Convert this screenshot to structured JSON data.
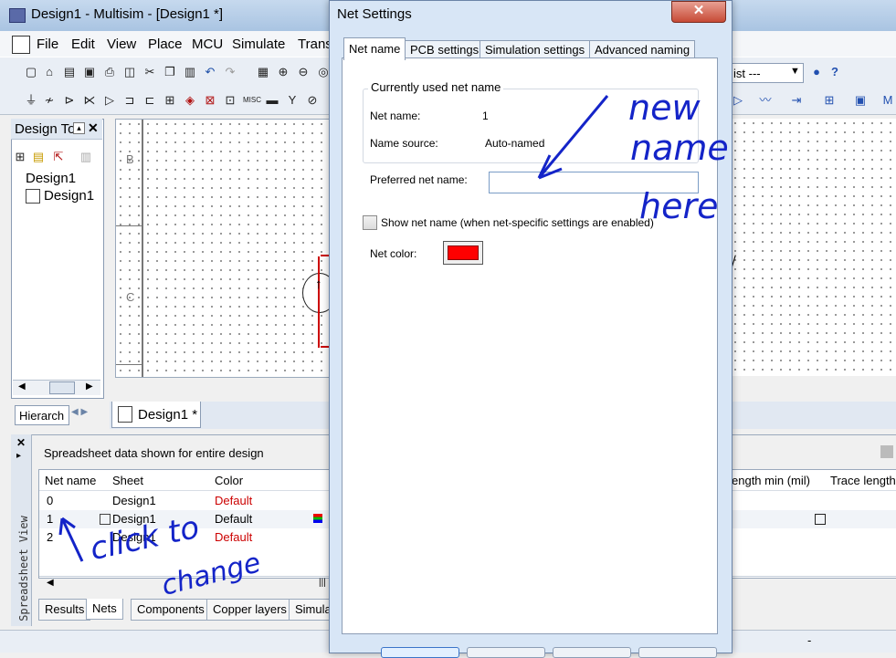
{
  "main_window": {
    "title": "Design1 - Multisim - [Design1 *]",
    "menu": [
      "File",
      "Edit",
      "View",
      "Place",
      "MCU",
      "Simulate",
      "Trans"
    ],
    "toolbar_dropdown": "ist ---"
  },
  "design_toolbox": {
    "title": "Design To",
    "tree": [
      "Design1",
      "Design1"
    ],
    "tab": "Hierarch"
  },
  "canvas": {
    "row_labels": [
      "B",
      "C"
    ],
    "sheet_tab": "Design1 *"
  },
  "spreadsheet": {
    "header_text": "Spreadsheet data shown for entire design",
    "columns": [
      "Net name",
      "Sheet",
      "Color"
    ],
    "right_columns": [
      "ength min (mil)",
      "Trace length"
    ],
    "rows": [
      {
        "net": "0",
        "sheet": "Design1",
        "color": "Default"
      },
      {
        "net": "1",
        "sheet": "Design1",
        "color": "Default"
      },
      {
        "net": "2",
        "sheet": "Design1",
        "color": "Default"
      }
    ],
    "side_label": "Spreadsheet View",
    "bottom_tabs": [
      "Results",
      "Nets",
      "Components",
      "Copper layers",
      "Simula"
    ],
    "status_dash": "-"
  },
  "dialog": {
    "title": "Net Settings",
    "close_glyph": "✕",
    "tabs": [
      "Net name",
      "PCB settings",
      "Simulation settings",
      "Advanced naming"
    ],
    "group_title": "Currently used net name",
    "net_name_label": "Net name:",
    "net_name_value": "1",
    "name_source_label": "Name source:",
    "name_source_value": "Auto-named",
    "preferred_label": "Preferred net name:",
    "preferred_value": "",
    "show_net_name_label": "Show net name (when net-specific settings are enabled)",
    "net_color_label": "Net color:",
    "net_color": "#ff0000"
  },
  "annotations": {
    "new_name_here": [
      "new",
      "name",
      "here"
    ],
    "click_to_change": [
      "click to",
      "change"
    ]
  }
}
